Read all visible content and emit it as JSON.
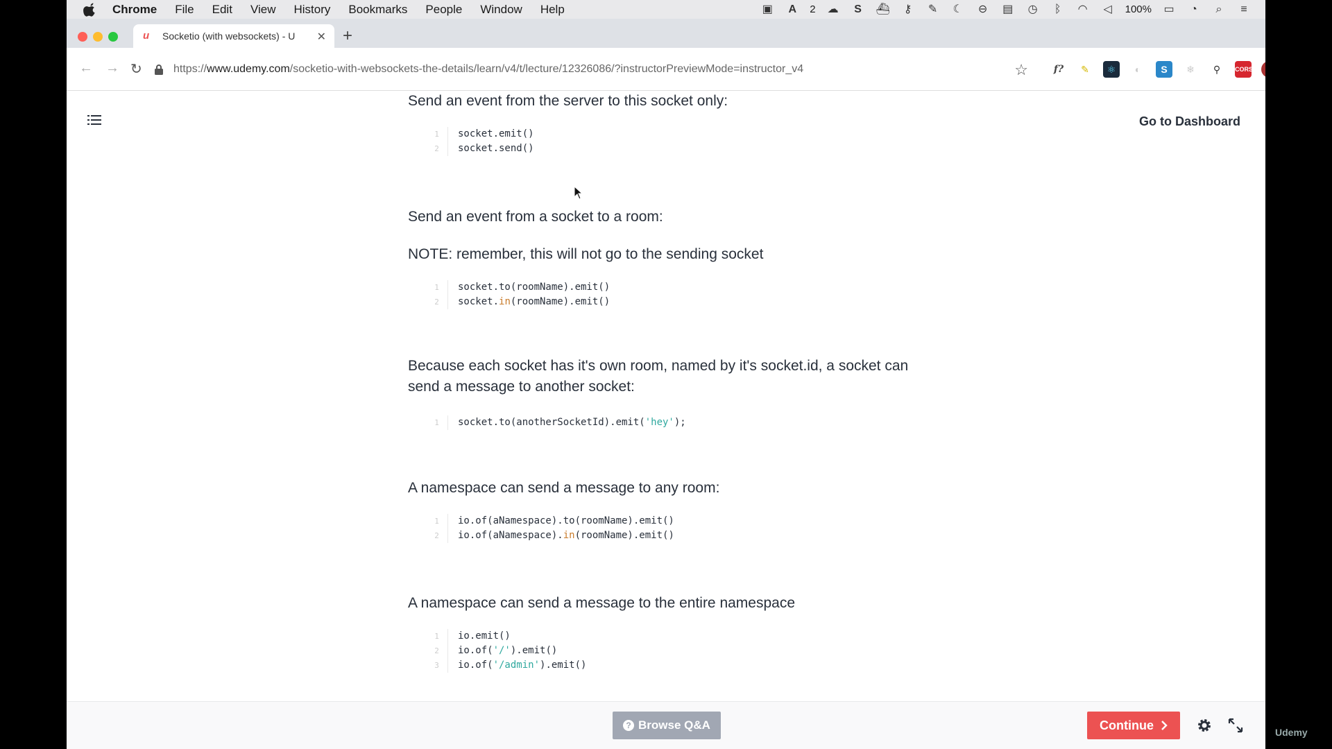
{
  "menubar": {
    "app": "Chrome",
    "items": [
      "File",
      "Edit",
      "View",
      "History",
      "Bookmarks",
      "People",
      "Window",
      "Help"
    ],
    "status_badge": "2",
    "battery": "100%",
    "icons": [
      "facetime-icon",
      "adobe-icon",
      "cloud-icon",
      "s-icon",
      "docker-icon",
      "key-icon",
      "evernote-icon",
      "moon-icon",
      "block-icon",
      "window-icon",
      "time-machine-icon",
      "bluetooth-icon",
      "wifi-icon",
      "volume-icon",
      "battery-icon",
      "clock-icon",
      "search-icon",
      "list-icon"
    ]
  },
  "browser": {
    "tab_title": "Socketio (with websockets) - U",
    "url_prefix": "https://",
    "url_host": "www.udemy.com",
    "url_path": "/socketio-with-websockets-the-details/learn/v4/t/lecture/12326086/?instructorPreviewMode=instructor_v4",
    "extensions": {
      "f": "f?",
      "s_badge": "S",
      "cors": "CORS"
    }
  },
  "page": {
    "dashboard_link": "Go to Dashboard",
    "sections": [
      {
        "text": "Send an event from the server to this socket only:"
      },
      {
        "text": "Send an event from a socket to a room:"
      },
      {
        "text": "NOTE: remember, this will not go to the sending socket"
      },
      {
        "text": "Because each socket has it's own room, named by it's socket.id, a socket can send a message to another socket:"
      },
      {
        "text": "A namespace can send a message to any room:"
      },
      {
        "text": "A namespace can send a message to the entire namespace"
      }
    ],
    "code_blocks": [
      [
        [
          "socket.emit()"
        ],
        [
          "socket.send()"
        ]
      ],
      [
        [
          "socket.to(roomName).emit()"
        ],
        [
          "socket.",
          "in",
          "(roomName).emit()"
        ]
      ],
      [
        [
          "socket.to(anotherSocketId).emit(",
          "'hey'",
          ");"
        ]
      ],
      [
        [
          "io.of(aNamespace).to(roomName).emit()"
        ],
        [
          "io.of(aNamespace).",
          "in",
          "(roomName).emit()"
        ]
      ],
      [
        [
          "io.emit()"
        ],
        [
          "io.of(",
          "'/'",
          ").emit()"
        ],
        [
          "io.of(",
          "'/admin'",
          ").emit()"
        ]
      ]
    ],
    "line_numbers": [
      "1",
      "2",
      "3"
    ]
  },
  "footer": {
    "browse_qa": "Browse Q&A",
    "continue": "Continue",
    "watermark": "Udemy"
  },
  "colors": {
    "accent": "#ec5252",
    "disabled_button": "#a1a7b3",
    "text": "#29303b",
    "code_keyword": "#c87b2a",
    "code_string": "#2ea89e"
  }
}
